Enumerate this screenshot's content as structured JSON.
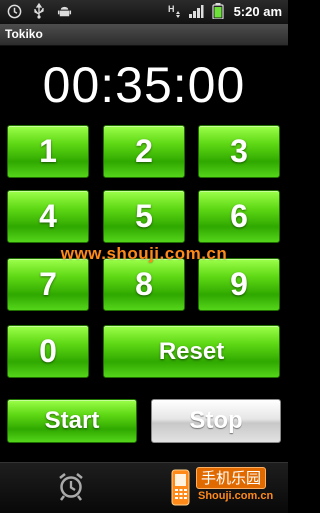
{
  "status_bar": {
    "time": "5:20 am",
    "icons": [
      "clock-icon",
      "usb-icon",
      "android-icon",
      "hsdpa-icon",
      "signal-icon",
      "battery-icon"
    ],
    "network_label": "H"
  },
  "app": {
    "title": "Tokiko"
  },
  "timer": {
    "display": "00:35:00"
  },
  "keypad": {
    "digits": [
      "1",
      "2",
      "3",
      "4",
      "5",
      "6",
      "7",
      "8",
      "9",
      "0"
    ],
    "reset_label": "Reset"
  },
  "controls": {
    "start_label": "Start",
    "stop_label": "Stop"
  },
  "watermark": {
    "text": "www.shouji.com.cn"
  },
  "bottom_bar": {
    "alarm_icon": "alarm-clock-icon",
    "brand_cn": "手机乐园",
    "brand_en": "Shouji.com.cn"
  },
  "colors": {
    "button_green": "#4fd01a",
    "button_gray": "#e0e0e0",
    "watermark": "#ff8a1a"
  }
}
